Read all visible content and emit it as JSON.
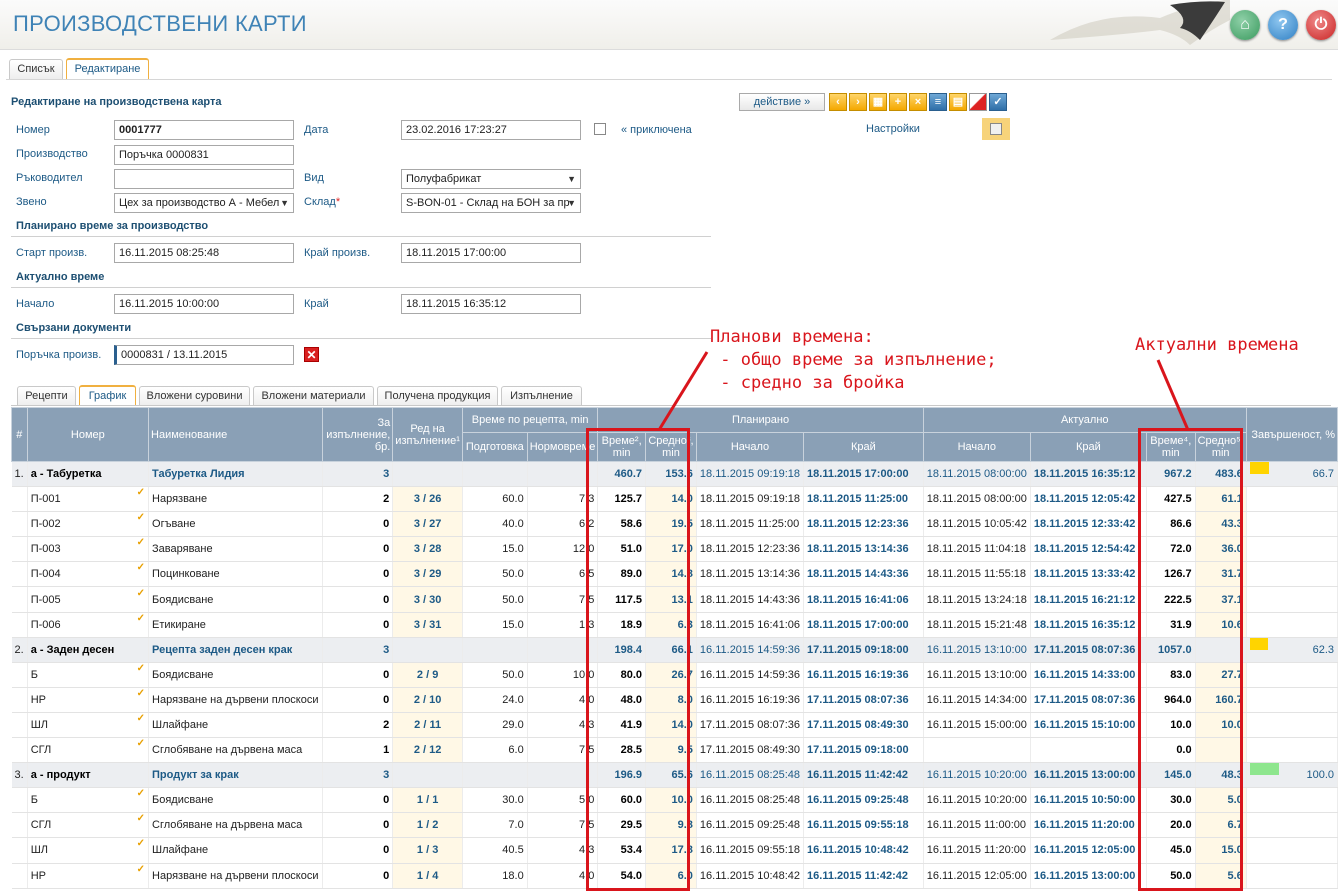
{
  "app": {
    "title": "ПРОИЗВОДСТВЕНИ КАРТИ"
  },
  "header_buttons": {
    "home": "⌂",
    "help": "?",
    "power": "⏻"
  },
  "main_tabs": [
    "Списък",
    "Редактиране"
  ],
  "form": {
    "title": "Редактиране на производствена карта",
    "action_label": "действие »",
    "fields": {
      "nomer_label": "Номер",
      "nomer": "0001777",
      "date_label": "Дата",
      "date": "23.02.2016 17:23:27",
      "closed_label": "« приключена",
      "settings_label": "Настройки",
      "proizvodstvo_label": "Производство",
      "proizvodstvo": "Поръчка 0000831",
      "rakovoditel_label": "Ръководител",
      "rakovoditel": "",
      "vid_label": "Вид",
      "vid": "Полуфабрикат",
      "zveno_label": "Звено",
      "zveno": "Цех за производство А - Мебел",
      "sklad_label": "Склад",
      "sklad_required": "*",
      "sklad": "S-BON-01 - Склад на БОН за пр"
    },
    "planned_section": "Планирано време за производство",
    "start_label": "Старт произв.",
    "start": "16.11.2015 08:25:48",
    "end_label": "Край произв.",
    "end": "18.11.2015 17:00:00",
    "actual_section": "Актуално време",
    "act_start_label": "Начало",
    "act_start": "16.11.2015 10:00:00",
    "act_end_label": "Край",
    "act_end": "18.11.2015 16:35:12",
    "linked_section": "Свързани документи",
    "order_label": "Поръчка произв.",
    "order": "0000831 / 13.11.2015"
  },
  "sub_tabs": [
    "Рецепти",
    "График",
    "Вложени суровини",
    "Вложени материали",
    "Получена продукция",
    "Изпълнение"
  ],
  "annotations": {
    "planned": "Планови времена:\n - общо време за изпълнение;\n - средно за бройка",
    "actual": "Актуални времена"
  },
  "table": {
    "headers": {
      "hash": "#",
      "nomer": "Номер",
      "name": "Наименование",
      "qty": "За изпълнение, бр.",
      "order": "Ред на изпълнение¹",
      "recipe_time": "Време по рецепта, min",
      "prep": "Подготовка",
      "norm": "Нормовреме",
      "planned": "Планирано",
      "actual": "Актуално",
      "p_time": "Време², min",
      "p_avg": "Средно³, min",
      "p_start": "Начало",
      "p_end": "Край",
      "a_start": "Начало",
      "a_end": "Край",
      "a_time": "Време⁴, min",
      "a_avg": "Средно⁵, min",
      "done": "Завършеност, %"
    },
    "rows": [
      {
        "g": true,
        "num": "1.",
        "nomer": "а - Табуретка",
        "name": "Табуретка Лидия",
        "qty": "3",
        "order": "",
        "prep": "",
        "norm": "",
        "pt": "460.7",
        "pa": "153.6",
        "ps": "18.11.2015 09:19:18",
        "pe": "18.11.2015 17:00:00",
        "as": "18.11.2015 08:00:00",
        "ae": "18.11.2015 16:35:12",
        "at": "967.2",
        "aa": "483.6",
        "done": "66.7",
        "pct": 0.3,
        "color": "#ffd400"
      },
      {
        "g": false,
        "num": "",
        "nomer": "П-001",
        "name": "Нарязване",
        "qty": "2",
        "order": "3 / 26",
        "prep": "60.0",
        "norm": "7.3",
        "pt": "125.7",
        "pa": "14.0",
        "ps": "18.11.2015 09:19:18",
        "pe": "18.11.2015 11:25:00",
        "as": "18.11.2015 08:00:00",
        "ae": "18.11.2015 12:05:42",
        "at": "427.5",
        "aa": "61.1",
        "done": ""
      },
      {
        "g": false,
        "num": "",
        "nomer": "П-002",
        "name": "Огъване",
        "qty": "0",
        "order": "3 / 27",
        "prep": "40.0",
        "norm": "6.2",
        "pt": "58.6",
        "pa": "19.5",
        "ps": "18.11.2015 11:25:00",
        "pe": "18.11.2015 12:23:36",
        "as": "18.11.2015 10:05:42",
        "ae": "18.11.2015 12:33:42",
        "at": "86.6",
        "aa": "43.3",
        "done": ""
      },
      {
        "g": false,
        "num": "",
        "nomer": "П-003",
        "name": "Заваряване",
        "qty": "0",
        "order": "3 / 28",
        "prep": "15.0",
        "norm": "12.0",
        "pt": "51.0",
        "pa": "17.0",
        "ps": "18.11.2015 12:23:36",
        "pe": "18.11.2015 13:14:36",
        "as": "18.11.2015 11:04:18",
        "ae": "18.11.2015 12:54:42",
        "at": "72.0",
        "aa": "36.0",
        "done": ""
      },
      {
        "g": false,
        "num": "",
        "nomer": "П-004",
        "name": "Поцинковане",
        "qty": "0",
        "order": "3 / 29",
        "prep": "50.0",
        "norm": "6.5",
        "pt": "89.0",
        "pa": "14.8",
        "ps": "18.11.2015 13:14:36",
        "pe": "18.11.2015 14:43:36",
        "as": "18.11.2015 11:55:18",
        "ae": "18.11.2015 13:33:42",
        "at": "126.7",
        "aa": "31.7",
        "done": ""
      },
      {
        "g": false,
        "num": "",
        "nomer": "П-005",
        "name": "Боядисване",
        "qty": "0",
        "order": "3 / 30",
        "prep": "50.0",
        "norm": "7.5",
        "pt": "117.5",
        "pa": "13.1",
        "ps": "18.11.2015 14:43:36",
        "pe": "18.11.2015 16:41:06",
        "as": "18.11.2015 13:24:18",
        "ae": "18.11.2015 16:21:12",
        "at": "222.5",
        "aa": "37.1",
        "done": ""
      },
      {
        "g": false,
        "num": "",
        "nomer": "П-006",
        "name": "Етикиране",
        "qty": "0",
        "order": "3 / 31",
        "prep": "15.0",
        "norm": "1.3",
        "pt": "18.9",
        "pa": "6.3",
        "ps": "18.11.2015 16:41:06",
        "pe": "18.11.2015 17:00:00",
        "as": "18.11.2015 15:21:48",
        "ae": "18.11.2015 16:35:12",
        "at": "31.9",
        "aa": "10.6",
        "done": ""
      },
      {
        "g": true,
        "num": "2.",
        "nomer": "а - Заден десен",
        "name": "Рецепта заден десен крак",
        "qty": "3",
        "order": "",
        "prep": "",
        "norm": "",
        "pt": "198.4",
        "pa": "66.1",
        "ps": "16.11.2015 14:59:36",
        "pe": "17.11.2015 09:18:00",
        "as": "16.11.2015 13:10:00",
        "ae": "17.11.2015 08:07:36",
        "at": "1057.0",
        "aa": "",
        "done": "62.3",
        "pct": 0.28,
        "color": "#ffd400"
      },
      {
        "g": false,
        "num": "",
        "nomer": "Б",
        "name": "Боядисване",
        "qty": "0",
        "order": "2 / 9",
        "prep": "50.0",
        "norm": "10.0",
        "pt": "80.0",
        "pa": "26.7",
        "ps": "16.11.2015 14:59:36",
        "pe": "16.11.2015 16:19:36",
        "as": "16.11.2015 13:10:00",
        "ae": "16.11.2015 14:33:00",
        "at": "83.0",
        "aa": "27.7",
        "done": ""
      },
      {
        "g": false,
        "num": "",
        "nomer": "НР",
        "name": "Нарязване на дървени плоскоси",
        "qty": "0",
        "order": "2 / 10",
        "prep": "24.0",
        "norm": "4.0",
        "pt": "48.0",
        "pa": "8.0",
        "ps": "16.11.2015 16:19:36",
        "pe": "17.11.2015 08:07:36",
        "as": "16.11.2015 14:34:00",
        "ae": "17.11.2015 08:07:36",
        "at": "964.0",
        "aa": "160.7",
        "done": ""
      },
      {
        "g": false,
        "num": "",
        "nomer": "ШЛ",
        "name": "Шлайфане",
        "qty": "2",
        "order": "2 / 11",
        "prep": "29.0",
        "norm": "4.3",
        "pt": "41.9",
        "pa": "14.0",
        "ps": "17.11.2015 08:07:36",
        "pe": "17.11.2015 08:49:30",
        "as": "16.11.2015 15:00:00",
        "ae": "16.11.2015 15:10:00",
        "at": "10.0",
        "aa": "10.0",
        "done": ""
      },
      {
        "g": false,
        "num": "",
        "nomer": "СГЛ",
        "name": "Сглобяване на дървена маса",
        "qty": "1",
        "order": "2 / 12",
        "prep": "6.0",
        "norm": "7.5",
        "pt": "28.5",
        "pa": "9.5",
        "ps": "17.11.2015 08:49:30",
        "pe": "17.11.2015 09:18:00",
        "as": "",
        "ae": "",
        "at": "0.0",
        "aa": "",
        "done": ""
      },
      {
        "g": true,
        "num": "3.",
        "nomer": "а - продукт",
        "name": "Продукт за крак",
        "qty": "3",
        "order": "",
        "prep": "",
        "norm": "",
        "pt": "196.9",
        "pa": "65.6",
        "ps": "16.11.2015 08:25:48",
        "pe": "16.11.2015 11:42:42",
        "as": "16.11.2015 10:20:00",
        "ae": "16.11.2015 13:00:00",
        "at": "145.0",
        "aa": "48.3",
        "done": "100.0",
        "pct": 0.45,
        "color": "#8ee68e"
      },
      {
        "g": false,
        "num": "",
        "nomer": "Б",
        "name": "Боядисване",
        "qty": "0",
        "order": "1 / 1",
        "prep": "30.0",
        "norm": "5.0",
        "pt": "60.0",
        "pa": "10.0",
        "ps": "16.11.2015 08:25:48",
        "pe": "16.11.2015 09:25:48",
        "as": "16.11.2015 10:20:00",
        "ae": "16.11.2015 10:50:00",
        "at": "30.0",
        "aa": "5.0",
        "done": ""
      },
      {
        "g": false,
        "num": "",
        "nomer": "СГЛ",
        "name": "Сглобяване на дървена маса",
        "qty": "0",
        "order": "1 / 2",
        "prep": "7.0",
        "norm": "7.5",
        "pt": "29.5",
        "pa": "9.8",
        "ps": "16.11.2015 09:25:48",
        "pe": "16.11.2015 09:55:18",
        "as": "16.11.2015 11:00:00",
        "ae": "16.11.2015 11:20:00",
        "at": "20.0",
        "aa": "6.7",
        "done": ""
      },
      {
        "g": false,
        "num": "",
        "nomer": "ШЛ",
        "name": "Шлайфане",
        "qty": "0",
        "order": "1 / 3",
        "prep": "40.5",
        "norm": "4.3",
        "pt": "53.4",
        "pa": "17.8",
        "ps": "16.11.2015 09:55:18",
        "pe": "16.11.2015 10:48:42",
        "as": "16.11.2015 11:20:00",
        "ae": "16.11.2015 12:05:00",
        "at": "45.0",
        "aa": "15.0",
        "done": ""
      },
      {
        "g": false,
        "num": "",
        "nomer": "НР",
        "name": "Нарязване на дървени плоскоси",
        "qty": "0",
        "order": "1 / 4",
        "prep": "18.0",
        "norm": "4.0",
        "pt": "54.0",
        "pa": "6.0",
        "ps": "16.11.2015 10:48:42",
        "pe": "16.11.2015 11:42:42",
        "as": "16.11.2015 12:05:00",
        "ae": "16.11.2015 13:00:00",
        "at": "50.0",
        "aa": "5.6",
        "done": ""
      }
    ]
  }
}
